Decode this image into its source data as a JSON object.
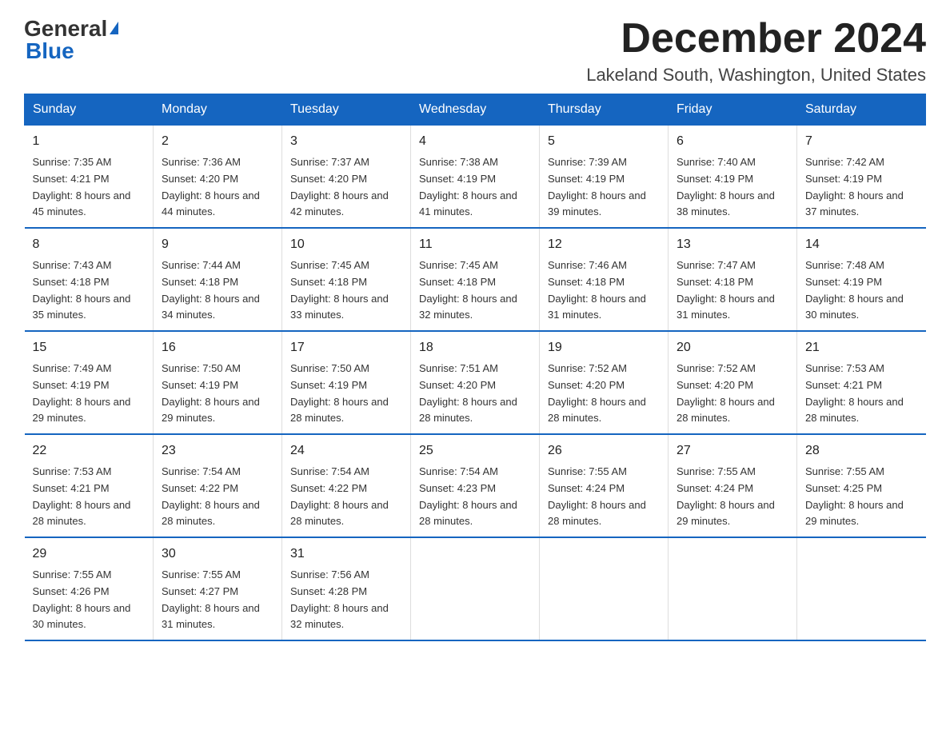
{
  "logo": {
    "general": "General",
    "triangle": "▲",
    "blue": "Blue"
  },
  "title": {
    "month_year": "December 2024",
    "location": "Lakeland South, Washington, United States"
  },
  "header_days": [
    "Sunday",
    "Monday",
    "Tuesday",
    "Wednesday",
    "Thursday",
    "Friday",
    "Saturday"
  ],
  "weeks": [
    [
      {
        "day": "1",
        "sunrise": "Sunrise: 7:35 AM",
        "sunset": "Sunset: 4:21 PM",
        "daylight": "Daylight: 8 hours and 45 minutes."
      },
      {
        "day": "2",
        "sunrise": "Sunrise: 7:36 AM",
        "sunset": "Sunset: 4:20 PM",
        "daylight": "Daylight: 8 hours and 44 minutes."
      },
      {
        "day": "3",
        "sunrise": "Sunrise: 7:37 AM",
        "sunset": "Sunset: 4:20 PM",
        "daylight": "Daylight: 8 hours and 42 minutes."
      },
      {
        "day": "4",
        "sunrise": "Sunrise: 7:38 AM",
        "sunset": "Sunset: 4:19 PM",
        "daylight": "Daylight: 8 hours and 41 minutes."
      },
      {
        "day": "5",
        "sunrise": "Sunrise: 7:39 AM",
        "sunset": "Sunset: 4:19 PM",
        "daylight": "Daylight: 8 hours and 39 minutes."
      },
      {
        "day": "6",
        "sunrise": "Sunrise: 7:40 AM",
        "sunset": "Sunset: 4:19 PM",
        "daylight": "Daylight: 8 hours and 38 minutes."
      },
      {
        "day": "7",
        "sunrise": "Sunrise: 7:42 AM",
        "sunset": "Sunset: 4:19 PM",
        "daylight": "Daylight: 8 hours and 37 minutes."
      }
    ],
    [
      {
        "day": "8",
        "sunrise": "Sunrise: 7:43 AM",
        "sunset": "Sunset: 4:18 PM",
        "daylight": "Daylight: 8 hours and 35 minutes."
      },
      {
        "day": "9",
        "sunrise": "Sunrise: 7:44 AM",
        "sunset": "Sunset: 4:18 PM",
        "daylight": "Daylight: 8 hours and 34 minutes."
      },
      {
        "day": "10",
        "sunrise": "Sunrise: 7:45 AM",
        "sunset": "Sunset: 4:18 PM",
        "daylight": "Daylight: 8 hours and 33 minutes."
      },
      {
        "day": "11",
        "sunrise": "Sunrise: 7:45 AM",
        "sunset": "Sunset: 4:18 PM",
        "daylight": "Daylight: 8 hours and 32 minutes."
      },
      {
        "day": "12",
        "sunrise": "Sunrise: 7:46 AM",
        "sunset": "Sunset: 4:18 PM",
        "daylight": "Daylight: 8 hours and 31 minutes."
      },
      {
        "day": "13",
        "sunrise": "Sunrise: 7:47 AM",
        "sunset": "Sunset: 4:18 PM",
        "daylight": "Daylight: 8 hours and 31 minutes."
      },
      {
        "day": "14",
        "sunrise": "Sunrise: 7:48 AM",
        "sunset": "Sunset: 4:19 PM",
        "daylight": "Daylight: 8 hours and 30 minutes."
      }
    ],
    [
      {
        "day": "15",
        "sunrise": "Sunrise: 7:49 AM",
        "sunset": "Sunset: 4:19 PM",
        "daylight": "Daylight: 8 hours and 29 minutes."
      },
      {
        "day": "16",
        "sunrise": "Sunrise: 7:50 AM",
        "sunset": "Sunset: 4:19 PM",
        "daylight": "Daylight: 8 hours and 29 minutes."
      },
      {
        "day": "17",
        "sunrise": "Sunrise: 7:50 AM",
        "sunset": "Sunset: 4:19 PM",
        "daylight": "Daylight: 8 hours and 28 minutes."
      },
      {
        "day": "18",
        "sunrise": "Sunrise: 7:51 AM",
        "sunset": "Sunset: 4:20 PM",
        "daylight": "Daylight: 8 hours and 28 minutes."
      },
      {
        "day": "19",
        "sunrise": "Sunrise: 7:52 AM",
        "sunset": "Sunset: 4:20 PM",
        "daylight": "Daylight: 8 hours and 28 minutes."
      },
      {
        "day": "20",
        "sunrise": "Sunrise: 7:52 AM",
        "sunset": "Sunset: 4:20 PM",
        "daylight": "Daylight: 8 hours and 28 minutes."
      },
      {
        "day": "21",
        "sunrise": "Sunrise: 7:53 AM",
        "sunset": "Sunset: 4:21 PM",
        "daylight": "Daylight: 8 hours and 28 minutes."
      }
    ],
    [
      {
        "day": "22",
        "sunrise": "Sunrise: 7:53 AM",
        "sunset": "Sunset: 4:21 PM",
        "daylight": "Daylight: 8 hours and 28 minutes."
      },
      {
        "day": "23",
        "sunrise": "Sunrise: 7:54 AM",
        "sunset": "Sunset: 4:22 PM",
        "daylight": "Daylight: 8 hours and 28 minutes."
      },
      {
        "day": "24",
        "sunrise": "Sunrise: 7:54 AM",
        "sunset": "Sunset: 4:22 PM",
        "daylight": "Daylight: 8 hours and 28 minutes."
      },
      {
        "day": "25",
        "sunrise": "Sunrise: 7:54 AM",
        "sunset": "Sunset: 4:23 PM",
        "daylight": "Daylight: 8 hours and 28 minutes."
      },
      {
        "day": "26",
        "sunrise": "Sunrise: 7:55 AM",
        "sunset": "Sunset: 4:24 PM",
        "daylight": "Daylight: 8 hours and 28 minutes."
      },
      {
        "day": "27",
        "sunrise": "Sunrise: 7:55 AM",
        "sunset": "Sunset: 4:24 PM",
        "daylight": "Daylight: 8 hours and 29 minutes."
      },
      {
        "day": "28",
        "sunrise": "Sunrise: 7:55 AM",
        "sunset": "Sunset: 4:25 PM",
        "daylight": "Daylight: 8 hours and 29 minutes."
      }
    ],
    [
      {
        "day": "29",
        "sunrise": "Sunrise: 7:55 AM",
        "sunset": "Sunset: 4:26 PM",
        "daylight": "Daylight: 8 hours and 30 minutes."
      },
      {
        "day": "30",
        "sunrise": "Sunrise: 7:55 AM",
        "sunset": "Sunset: 4:27 PM",
        "daylight": "Daylight: 8 hours and 31 minutes."
      },
      {
        "day": "31",
        "sunrise": "Sunrise: 7:56 AM",
        "sunset": "Sunset: 4:28 PM",
        "daylight": "Daylight: 8 hours and 32 minutes."
      },
      null,
      null,
      null,
      null
    ]
  ]
}
